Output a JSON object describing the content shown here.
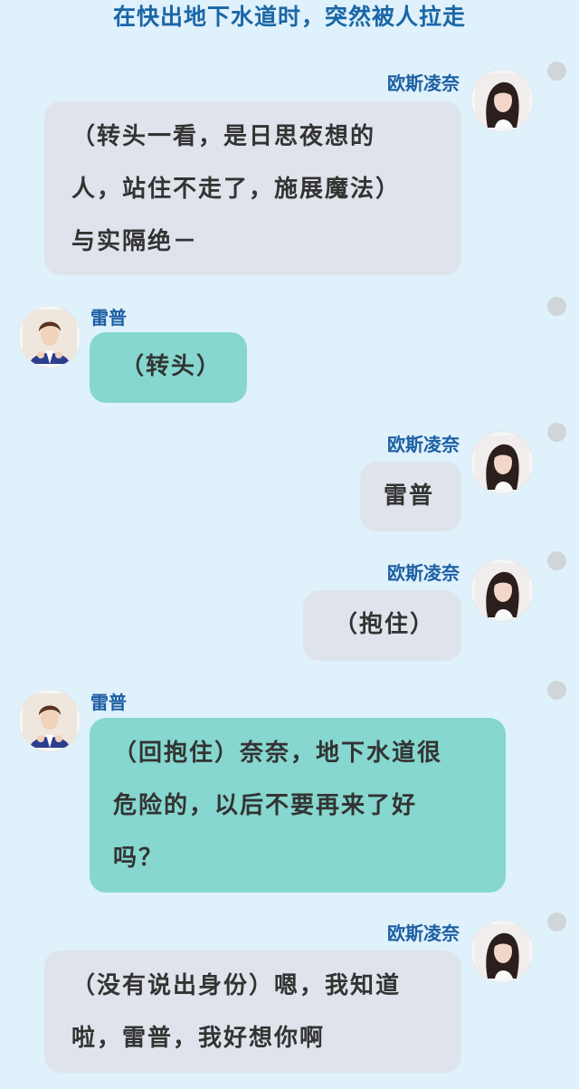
{
  "title": "在快出地下水道时，突然被人拉走",
  "messages": [
    {
      "sender": "欧斯凌奈",
      "side": "right",
      "lines": [
        "（转头一看，是日思夜想的",
        "人，站住不走了，施展魔法）",
        "与实隔绝－"
      ]
    },
    {
      "sender": "雷普",
      "side": "left",
      "lines": [
        "（转头）"
      ]
    },
    {
      "sender": "欧斯凌奈",
      "side": "right",
      "lines": [
        "雷普"
      ]
    },
    {
      "sender": "欧斯凌奈",
      "side": "right",
      "lines": [
        "（抱住）"
      ]
    },
    {
      "sender": "雷普",
      "side": "left",
      "lines": [
        "（回抱住）奈奈，地下水道很",
        "危险的，以后不要再来了好",
        "吗？"
      ]
    },
    {
      "sender": "欧斯凌奈",
      "side": "right",
      "lines": [
        "（没有说出身份）嗯，我知道",
        "啦，雷普，我好想你啊"
      ]
    }
  ],
  "colors": {
    "background": "#dff1fb",
    "title": "#1a66a6",
    "sender_name": "#1d5fa3",
    "bubble_right": "#dfe4ec",
    "bubble_left": "#86d7cf",
    "menu_dot": "#d0d5d9"
  }
}
